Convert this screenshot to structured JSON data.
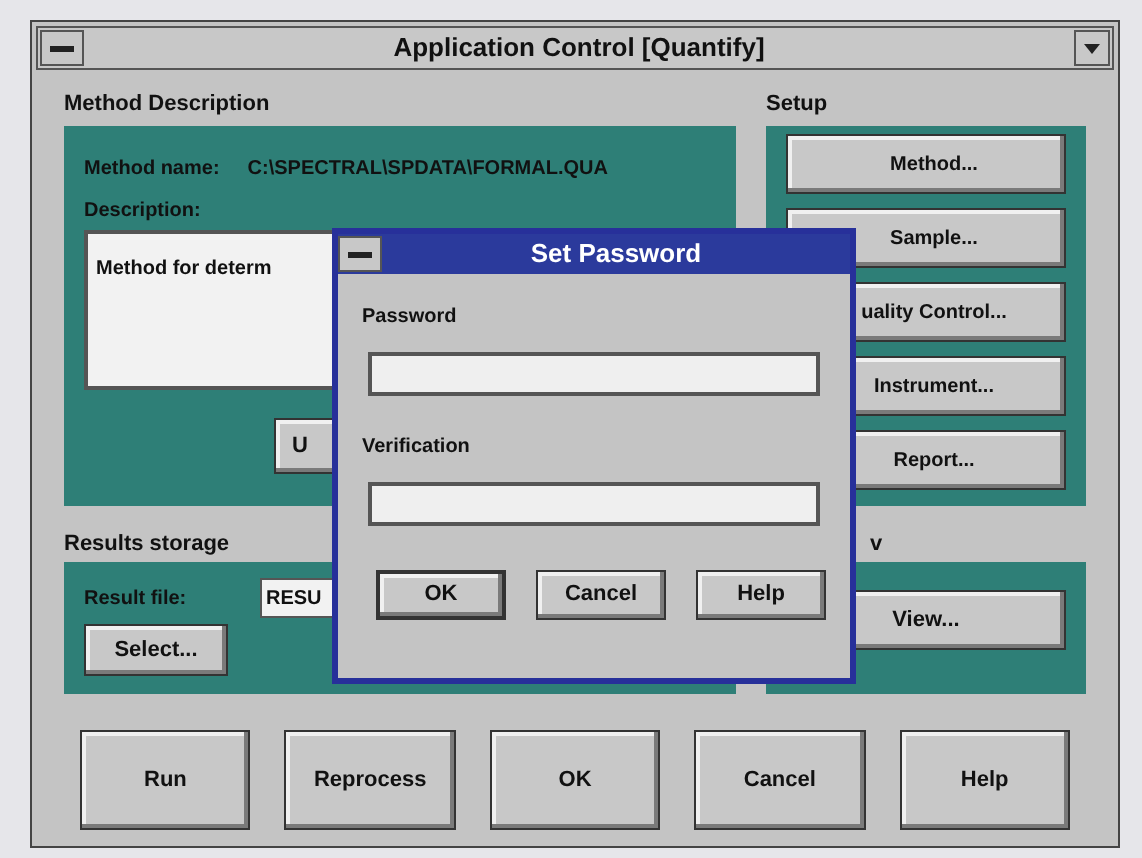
{
  "window": {
    "title": "Application Control [Quantify]"
  },
  "method_description": {
    "label": "Method Description",
    "name_label": "Method name:",
    "name_value": "C:\\SPECTRAL\\SPDATA\\FORMAL.QUA",
    "description_label": "Description:",
    "description_value": "Method for determ",
    "button": "U"
  },
  "results_storage": {
    "label": "Results storage",
    "file_label": "Result file:",
    "file_value": "RESU",
    "button": "Select..."
  },
  "setup": {
    "label": "Setup",
    "buttons": [
      "Method...",
      "Sample...",
      "uality Control...",
      "Instrument...",
      "Report..."
    ]
  },
  "view_group": {
    "label": "v",
    "button": "View..."
  },
  "bottom_buttons": [
    "Run",
    "Reprocess",
    "OK",
    "Cancel",
    "Help"
  ],
  "dialog": {
    "title": "Set Password",
    "fields": [
      {
        "label": "Password"
      },
      {
        "label": "Verification"
      }
    ],
    "buttons": [
      "OK",
      "Cancel",
      "Help"
    ]
  }
}
